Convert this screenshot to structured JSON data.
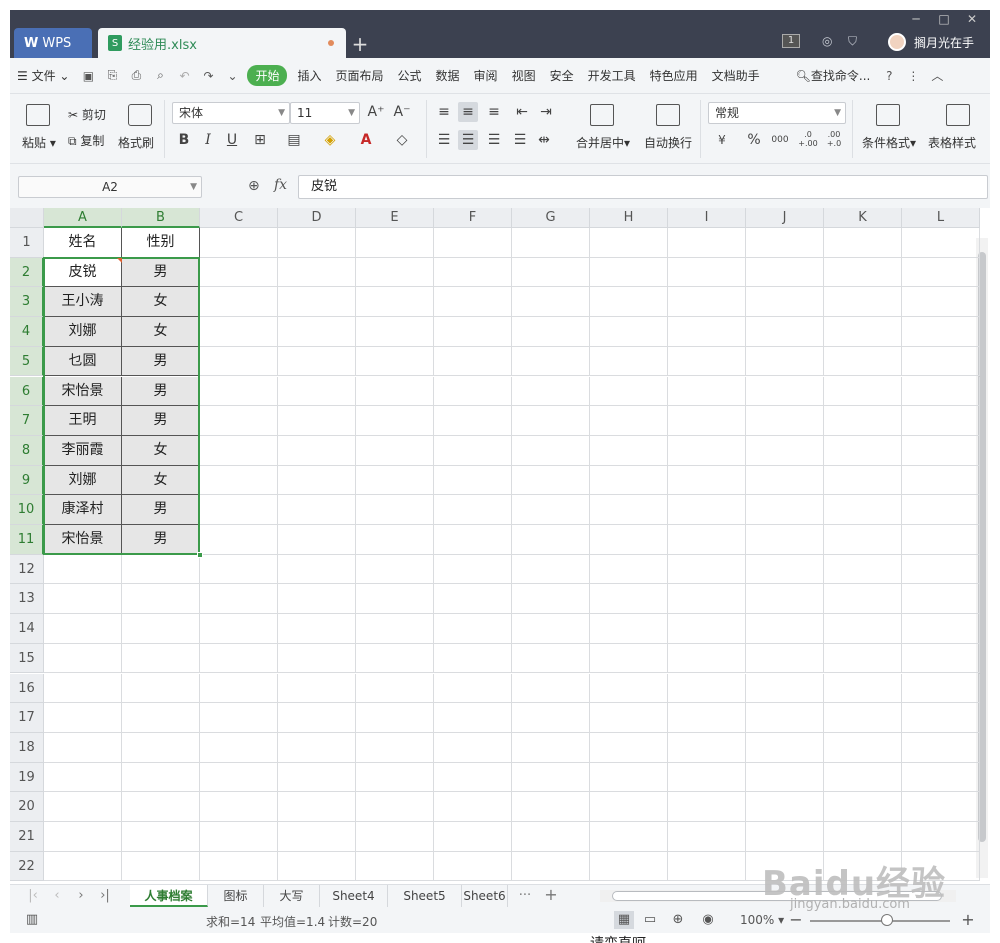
{
  "titlebar": {
    "app_tab": "WPS",
    "file_tab": "经验用.xlsx",
    "new_tab": "+",
    "page_badge": "1",
    "username": "搁月光在手",
    "window_controls": [
      "─",
      "□",
      "✕"
    ]
  },
  "menu": {
    "file_label": "文件",
    "items": [
      "开始",
      "插入",
      "页面布局",
      "公式",
      "数据",
      "审阅",
      "视图",
      "安全",
      "开发工具",
      "特色应用",
      "文档助手"
    ],
    "active_index": 0,
    "search_label": "查找命令..."
  },
  "ribbon": {
    "paste": "粘贴",
    "cut": "剪切",
    "copy": "复制",
    "format_painter": "格式刷",
    "font_name": "宋体",
    "font_size": "11",
    "number_format": "常规",
    "merge_center": "合并居中",
    "wrap_text": "自动换行",
    "conditional_format": "条件格式",
    "table_style": "表格样式",
    "bold": "B",
    "italic": "I",
    "underline": "U",
    "font_grow": "A⁺",
    "font_shrink": "A⁻",
    "percent": "%",
    "thousands": "000",
    "dec_inc": ".0 +.00",
    "dec_dec": ".00 +.0",
    "currency": "¥"
  },
  "formula_bar": {
    "name_box": "A2",
    "fx": "fx",
    "content": "皮锐"
  },
  "grid": {
    "columns": [
      "A",
      "B",
      "C",
      "D",
      "E",
      "F",
      "G",
      "H",
      "I",
      "J",
      "K",
      "L"
    ],
    "rows": [
      "1",
      "2",
      "3",
      "4",
      "5",
      "6",
      "7",
      "8",
      "9",
      "10",
      "11",
      "12",
      "13",
      "14",
      "15",
      "16",
      "17",
      "18",
      "19",
      "20",
      "21",
      "22"
    ],
    "header_row": [
      "姓名",
      "性别"
    ],
    "data": [
      [
        "皮锐",
        "男"
      ],
      [
        "王小涛",
        "女"
      ],
      [
        "刘娜",
        "女"
      ],
      [
        "乜圆",
        "男"
      ],
      [
        "宋怡景",
        "男"
      ],
      [
        "王明",
        "男"
      ],
      [
        "李丽霞",
        "女"
      ],
      [
        "刘娜",
        "女"
      ],
      [
        "康泽村",
        "男"
      ],
      [
        "宋怡景",
        "男"
      ]
    ]
  },
  "sheets": {
    "tabs": [
      "人事档案",
      "图标",
      "大写",
      "Sheet4",
      "Sheet5",
      "Sheet6"
    ],
    "active_index": 0,
    "more": "···",
    "add": "+"
  },
  "status": {
    "sum": "求和=14",
    "average": "平均值=1.4",
    "count": "计数=20",
    "zoom": "100%",
    "zoom_value": 100
  },
  "below_window_text": "请变直呵",
  "watermark": {
    "brand": "Baidu经验",
    "url": "jingyan.baidu.com"
  },
  "colors": {
    "titlebar": "#3c4150",
    "accent_green": "#4caf50",
    "selection_border": "#3b9a4a",
    "wps_tab": "#4a6fb5"
  }
}
